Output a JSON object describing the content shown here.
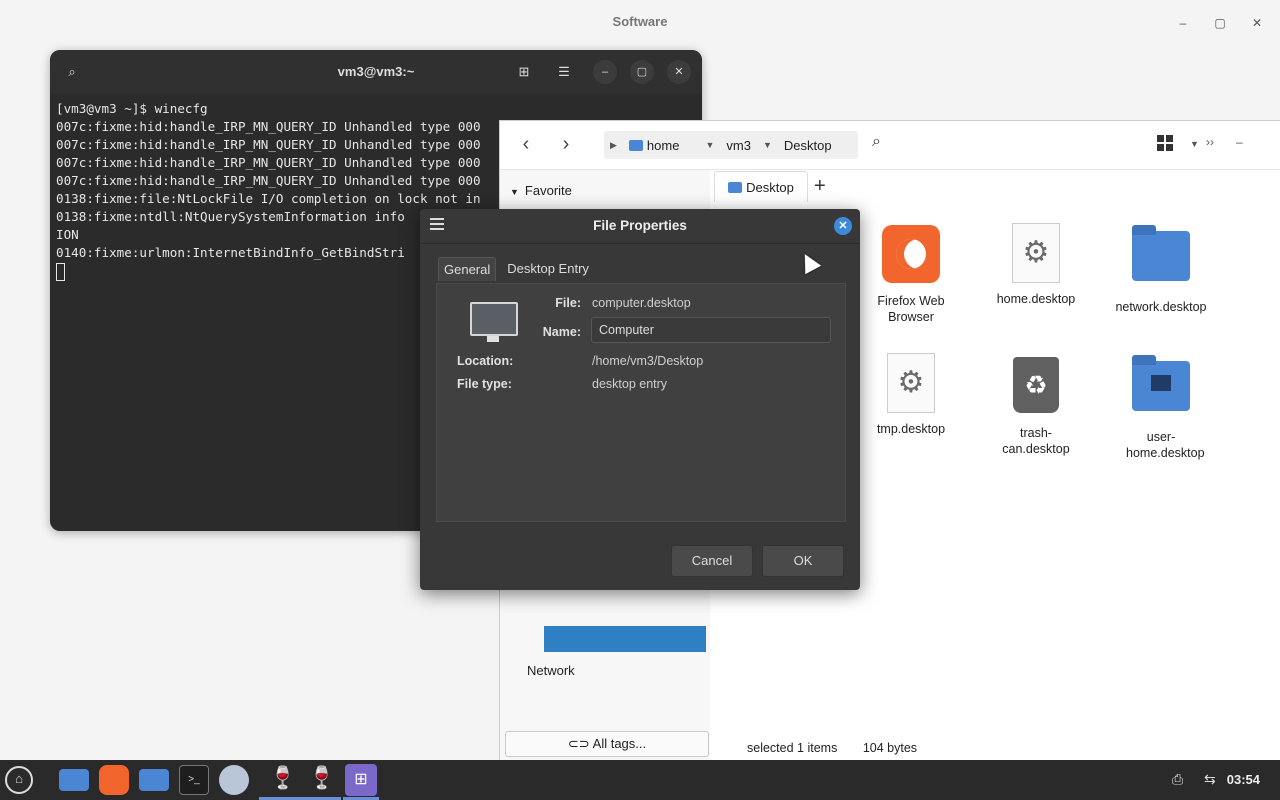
{
  "software_window": {
    "title": "Software"
  },
  "terminal": {
    "title": "vm3@vm3:~",
    "lines": [
      "[vm3@vm3 ~]$ winecfg",
      "007c:fixme:hid:handle_IRP_MN_QUERY_ID Unhandled type 000",
      "007c:fixme:hid:handle_IRP_MN_QUERY_ID Unhandled type 000",
      "007c:fixme:hid:handle_IRP_MN_QUERY_ID Unhandled type 000",
      "007c:fixme:hid:handle_IRP_MN_QUERY_ID Unhandled type 000",
      "0138:fixme:file:NtLockFile I/O completion on lock not in",
      "0138:fixme:ntdll:NtQuerySystemInformation info",
      "ION",
      "0140:fixme:urlmon:InternetBindInfo_GetBindStri"
    ]
  },
  "file_manager": {
    "breadcrumbs": [
      "home",
      "vm3",
      "Desktop"
    ],
    "sidebar": {
      "heading": "Favorite",
      "network": "Network",
      "all_tags": "All tags..."
    },
    "tab": {
      "label": "Desktop"
    },
    "files": [
      {
        "name": "Firefox Web Browser",
        "icon": "firefox-icon"
      },
      {
        "name": "home.desktop",
        "icon": "gear-document-icon"
      },
      {
        "name": "network.desktop",
        "icon": "folder-icon"
      },
      {
        "name": "tmp.desktop",
        "icon": "gear-document-icon"
      },
      {
        "name": "trash-can.desktop",
        "icon": "trash-icon"
      },
      {
        "name": "user-home.desktop",
        "icon": "home-folder-icon"
      }
    ],
    "status": {
      "selected": "selected 1 items",
      "size": "104 bytes"
    }
  },
  "dialog": {
    "title": "File Properties",
    "tabs": [
      "General",
      "Desktop Entry"
    ],
    "labels": {
      "file": "File:",
      "name": "Name:",
      "location": "Location:",
      "file_type": "File type:"
    },
    "values": {
      "file": "computer.desktop",
      "name": "Computer",
      "location": "/home/vm3/Desktop",
      "file_type": "desktop entry"
    },
    "buttons": {
      "cancel": "Cancel",
      "ok": "OK"
    }
  },
  "taskbar": {
    "clock": "03:54"
  },
  "colors": {
    "accent": "#3d8bd8",
    "selection": "#2f7fc4",
    "folder": "#4a86d4",
    "firefox": "#f2652c"
  }
}
